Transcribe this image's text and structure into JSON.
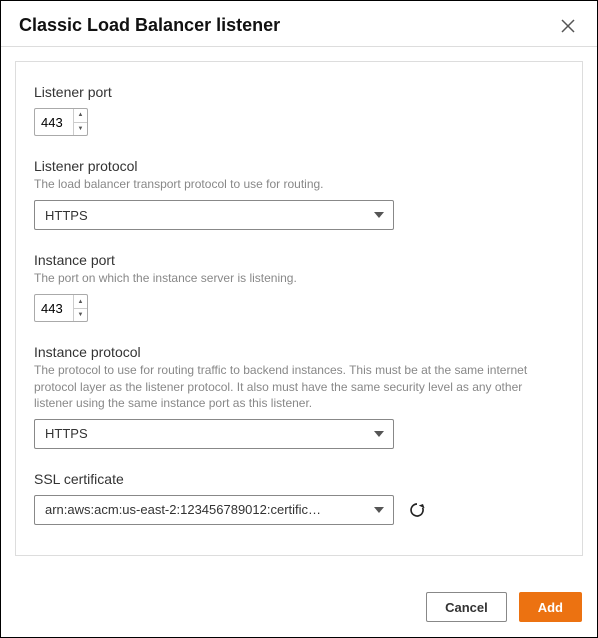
{
  "header": {
    "title": "Classic Load Balancer listener"
  },
  "fields": {
    "listener_port": {
      "label": "Listener port",
      "value": "443"
    },
    "listener_protocol": {
      "label": "Listener protocol",
      "desc": "The load balancer transport protocol to use for routing.",
      "value": "HTTPS"
    },
    "instance_port": {
      "label": "Instance port",
      "desc": "The port on which the instance server is listening.",
      "value": "443"
    },
    "instance_protocol": {
      "label": "Instance protocol",
      "desc": "The protocol to use for routing traffic to backend instances. This must be at the same internet protocol layer as the listener protocol. It also must have the same security level as any other listener using the same instance port as this listener.",
      "value": "HTTPS"
    },
    "ssl_certificate": {
      "label": "SSL certificate",
      "value": "arn:aws:acm:us-east-2:123456789012:certific…"
    }
  },
  "footer": {
    "cancel": "Cancel",
    "add": "Add"
  }
}
